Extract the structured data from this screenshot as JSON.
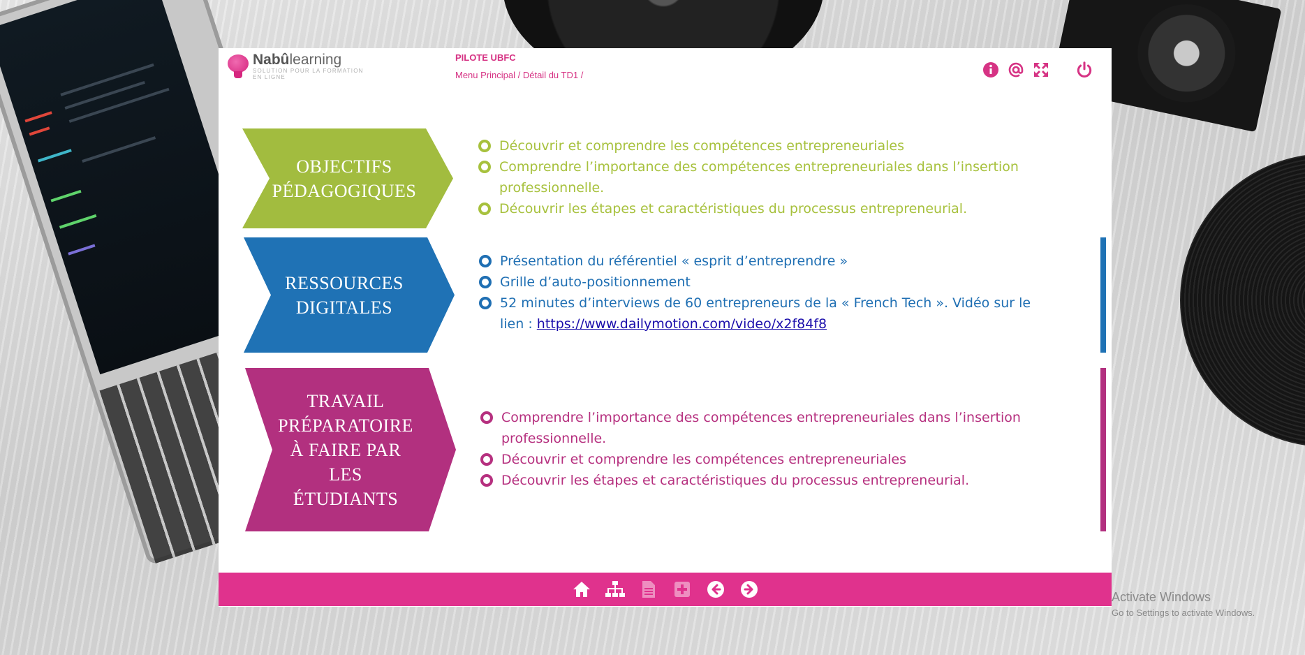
{
  "header": {
    "logo_name_prefix": "Nabû",
    "logo_name_suffix": "learning",
    "logo_tagline": "SOLUTION POUR LA FORMATION EN LIGNE",
    "site": "PILOTE UBFC",
    "breadcrumb": [
      "Menu Principal",
      "Détail du TD1"
    ],
    "breadcrumb_separator": " / ",
    "icons": [
      "info-icon",
      "at-email-icon",
      "fullscreen-icon",
      "power-icon"
    ]
  },
  "sections": [
    {
      "title_lines": [
        "OBJECTIFS",
        "PÉDAGOGIQUES"
      ],
      "color": "#a2bc3f",
      "items": [
        "Découvrir et comprendre les compétences entrepreneuriales",
        "Comprendre l’importance des compétences entrepreneuriales dans l’insertion professionnelle.",
        "Découvrir les étapes et caractéristiques du processus entrepreneurial."
      ]
    },
    {
      "title_lines": [
        "RESSOURCES",
        "DIGITALES"
      ],
      "color": "#1f72b5",
      "items": [
        "Présentation du référentiel « esprit d’entreprendre »",
        "Grille d’auto-positionnement",
        "52 minutes d’interviews de 60 entrepreneurs de la « French Tech ». Vidéo sur le lien :"
      ],
      "link": "https://www.dailymotion.com/video/x2f84f8"
    },
    {
      "title_lines": [
        "TRAVAIL",
        "PRÉPARATOIRE",
        "À FAIRE PAR",
        "LES",
        "ÉTUDIANTS"
      ],
      "color": "#b2307f",
      "items": [
        "Comprendre l’importance des compétences entrepreneuriales dans l’insertion professionnelle.",
        "Découvrir et comprendre les compétences entrepreneuriales",
        "Découvrir les étapes et caractéristiques du processus entrepreneurial."
      ]
    }
  ],
  "footer": {
    "buttons": [
      "home-icon",
      "sitemap-icon",
      "document-icon",
      "plus-icon",
      "arrow-left-icon",
      "arrow-right-icon"
    ],
    "accent": "#e0328d"
  },
  "watermark": {
    "line1": "Activate Windows",
    "line2": "Go to Settings to activate Windows."
  }
}
